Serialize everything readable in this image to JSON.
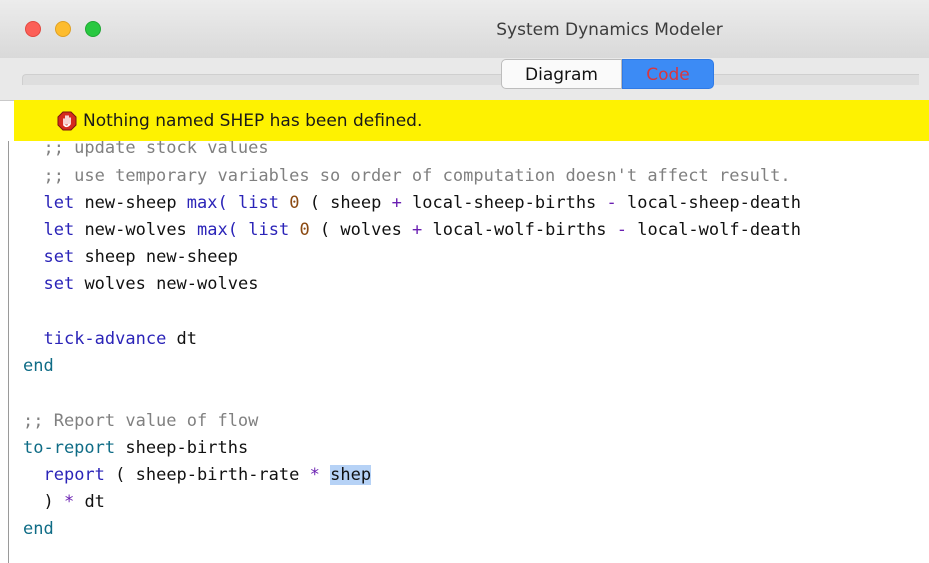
{
  "window": {
    "title": "System Dynamics Modeler"
  },
  "tabs": [
    {
      "label": "Diagram",
      "active": false
    },
    {
      "label": "Code",
      "active": true
    }
  ],
  "error": {
    "icon": "stop-hand-icon",
    "message": "Nothing named SHEP has been defined."
  },
  "code": {
    "lines": {
      "l0": {
        "text": "  ;; update stock values"
      },
      "l1": {
        "text": "  ;; use temporary variables so order of computation doesn't affect result."
      },
      "l2": {
        "a": "  ",
        "let": "let",
        "b": " new-sheep ",
        "max": "max(",
        "c": " ",
        "list": "list",
        "d": " ",
        "zero": "0",
        "e": " ( sheep ",
        "plus": "+",
        "f": " local-sheep-births ",
        "minus": "-",
        "g": " local-sheep-death"
      },
      "l3": {
        "a": "  ",
        "let": "let",
        "b": " new-wolves ",
        "max": "max(",
        "c": " ",
        "list": "list",
        "d": " ",
        "zero": "0",
        "e": " ( wolves ",
        "plus": "+",
        "f": " local-wolf-births ",
        "minus": "-",
        "g": " local-wolf-death"
      },
      "l4": {
        "a": "  ",
        "set": "set",
        "b": " sheep new-sheep"
      },
      "l5": {
        "a": "  ",
        "set": "set",
        "b": " wolves new-wolves"
      },
      "l7": {
        "a": "  ",
        "tick": "tick-advance",
        "b": " dt"
      },
      "l8": {
        "end": "end"
      },
      "l10": {
        "text": ";; Report value of flow"
      },
      "l11": {
        "toreport": "to-report",
        "b": " sheep-births"
      },
      "l12": {
        "a": "  ",
        "report": "report",
        "b": " ( sheep-birth-rate ",
        "star": "*",
        "c": " ",
        "shep": "shep"
      },
      "l13": {
        "a": "  ) ",
        "star": "*",
        "b": " dt"
      },
      "l14": {
        "end": "end"
      }
    }
  },
  "colors": {
    "banner": "#fef201",
    "keyword": "#0f6c86",
    "command": "#2b24b8",
    "number": "#8b4a12",
    "operator": "#6a1fb2",
    "comment": "#808080",
    "highlight": "#b6d2f6"
  }
}
